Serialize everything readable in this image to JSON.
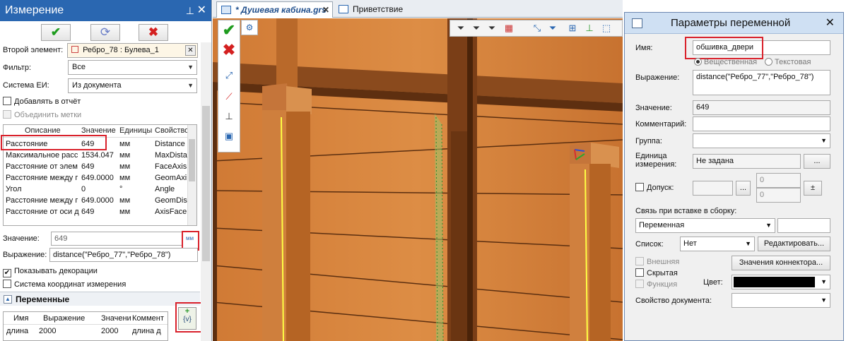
{
  "left_panel": {
    "title": "Измерение",
    "pin_glyph": "⊥",
    "close_glyph": "✕",
    "second_element_label": "Второй элемент:",
    "second_element_value": "Ребро_78 : Булева_1",
    "filter_label": "Фильтр:",
    "filter_value": "Все",
    "units_system_label": "Система ЕИ:",
    "units_system_value": "Из документа",
    "add_to_report": "Добавлять в отчёт",
    "merge_marks": "Объединить метки",
    "table": {
      "headers": [
        "Описание",
        "Значение",
        "Единицы",
        "Свойство"
      ],
      "rows": [
        [
          "Расстояние",
          "649",
          "мм",
          "Distance"
        ],
        [
          "Максимальное расс",
          "1534.047",
          "мм",
          "MaxDista"
        ],
        [
          "Расстояние от элем",
          "649",
          "мм",
          "FaceAxis"
        ],
        [
          "Расстояние между г",
          "649.0000",
          "мм",
          "GeomAxi"
        ],
        [
          "Угол",
          "0",
          "°",
          "Angle"
        ],
        [
          "Расстояние между г",
          "649.0000",
          "мм",
          "GeomDis"
        ],
        [
          "Расстояние от оси д",
          "649",
          "мм",
          "AxisFace"
        ]
      ]
    },
    "value_label": "Значение:",
    "value": "649",
    "unit_btn": "мм",
    "expression_label": "Выражение:",
    "expression": "distance(\"Ребро_77\",\"Ребро_78\")",
    "show_decorations": "Показывать декорации",
    "measure_cs": "Система координат измерения",
    "variables_title": "Переменные",
    "add_var_icon_text": "{v}",
    "vars_table": {
      "headers": [
        "Имя",
        "Выражение",
        "Значени",
        "Коммент"
      ],
      "rows": [
        [
          "длина",
          "2000",
          "2000",
          "длина д"
        ]
      ]
    }
  },
  "tabs": [
    {
      "label": "* Душевая кабина.grs"
    },
    {
      "label": "Приветствие"
    }
  ],
  "dialog": {
    "title": "Параметры переменной",
    "name_label": "Имя:",
    "name_value": "обшивка_двери",
    "radio_real": "Вещественная",
    "radio_text": "Текстовая",
    "expr_label": "Выражение:",
    "expr_value": "distance(\"Ребро_77\",\"Ребро_78\")",
    "value_label": "Значение:",
    "value": "649",
    "comment_label": "Комментарий:",
    "group_label": "Группа:",
    "unit_label_1": "Единица",
    "unit_label_2": "измерения:",
    "unit_value": "Не задана",
    "dots": "...",
    "tolerance_label": "Допуск:",
    "tol_upper": "0",
    "tol_lower": "0",
    "pm": "±",
    "link_label": "Связь при вставке в сборку:",
    "link_value": "Переменная",
    "list_label": "Список:",
    "list_value": "Нет",
    "edit_btn": "Редактировать...",
    "external": "Внешняя",
    "hidden": "Скрытая",
    "function": "Функция",
    "connector_btn": "Значения коннектора...",
    "color_label": "Цвет:",
    "doc_prop_label": "Свойство документа:"
  }
}
